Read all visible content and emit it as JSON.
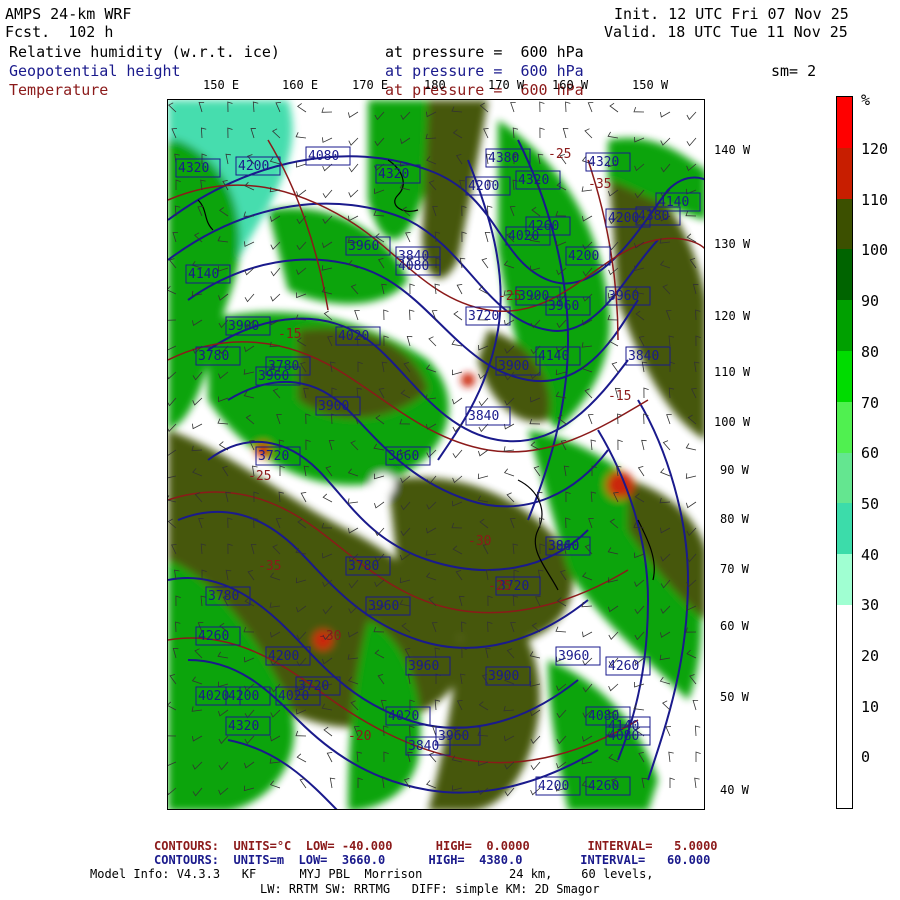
{
  "header": {
    "model": "AMPS 24-km WRF",
    "fcst": "Fcst.  102 h",
    "init": "Init. 12 UTC Fri 07 Nov 25",
    "valid": "Valid. 18 UTC Tue 11 Nov 25"
  },
  "fields": [
    {
      "name": "Relative humidity (w.r.t. ice)",
      "level": "at pressure =  600 hPa",
      "color": "#000000"
    },
    {
      "name": "Geopotential height",
      "level": "at pressure =  600 hPa",
      "color": "#1a1a8c"
    },
    {
      "name": "Temperature",
      "level": "at pressure =  600 hPa",
      "color": "#8b1a1a"
    }
  ],
  "smoothing": "sm= 2",
  "map": {
    "lon_labels_top": [
      "150 E",
      "160 E",
      "170 E",
      "180",
      "170 W",
      "160 W",
      "150 W"
    ],
    "lat_labels_right": [
      "140 W",
      "130 W",
      "120 W",
      "110 W",
      "100 W",
      "90 W",
      "80 W",
      "70 W",
      "60 W",
      "50 W",
      "40 W"
    ],
    "height_labels": [
      "4320",
      "4200",
      "4080",
      "4320",
      "4200",
      "4320",
      "4380",
      "4320",
      "4200",
      "4140",
      "4260",
      "4200",
      "3960",
      "4380",
      "4020",
      "4140",
      "3780",
      "3720",
      "4020",
      "4080",
      "3960",
      "3900",
      "3660",
      "3720",
      "3900",
      "3840",
      "3780",
      "3960",
      "3900",
      "3960",
      "3840",
      "3900",
      "3780",
      "3840",
      "3840",
      "3720",
      "3960",
      "3900",
      "3960",
      "3780",
      "3720",
      "4020",
      "3960",
      "3840",
      "4200",
      "4260",
      "3960",
      "4080",
      "4140",
      "4320",
      "4200",
      "4020",
      "4260",
      "4200",
      "4260",
      "3960",
      "4140",
      "4080",
      "4020"
    ],
    "temp_labels": [
      "-25",
      "-35",
      "-15",
      "-25",
      "-30",
      "-25",
      "-30",
      "-20",
      "-15",
      "-35",
      "-25"
    ],
    "colors": {
      "contour_height": "#1a1a8c",
      "contour_temp": "#8b1a1a",
      "coast": "#000000"
    }
  },
  "colorbar": {
    "unit": "%",
    "labels": [
      "120",
      "110",
      "100",
      "90",
      "80",
      "70",
      "60",
      "50",
      "40",
      "30",
      "20",
      "10",
      "0"
    ],
    "colors": [
      "#ff0000",
      "#c81e00",
      "#3c5000",
      "#006400",
      "#00a000",
      "#00dc00",
      "#50f050",
      "#64e690",
      "#3cdcaa",
      "#a0ffd2",
      "#ffffff",
      "#ffffff",
      "#ffffff",
      "#ffffff"
    ]
  },
  "footer": {
    "line1_label": "CONTOURS:  UNITS=°C  LOW= -40.000      HIGH=  0.0000        INTERVAL=   5.0000",
    "line2_label": "CONTOURS:  UNITS=m  LOW=  3660.0      HIGH=  4380.0        INTERVAL=   60.000",
    "model_info": "Model Info: V4.3.3   KF      MYJ PBL  Morrison            24 km,    60 levels,",
    "model_info2": "LW: RRTM SW: RRTMG   DIFF: simple KM: 2D Smagor"
  }
}
